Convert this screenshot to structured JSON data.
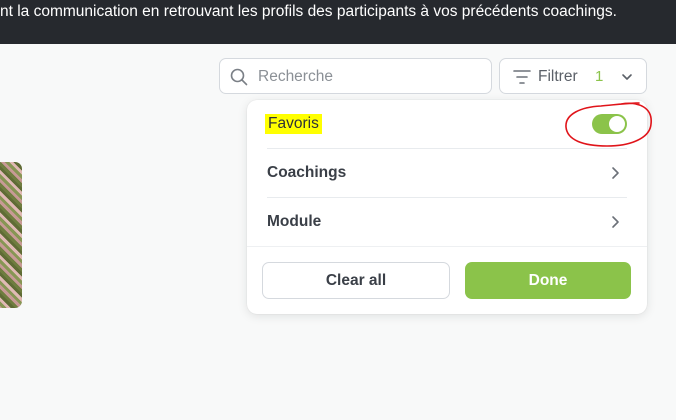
{
  "banner": {
    "text": "nt la communication en retrouvant les profils des participants à vos précédents coachings."
  },
  "search": {
    "placeholder": "Recherche",
    "icon": "search-icon"
  },
  "filter": {
    "label": "Filtrer",
    "count": "1",
    "icon": "filter-icon",
    "chevron_icon": "chevron-down-icon"
  },
  "dropdown": {
    "favorites": {
      "label": "Favoris",
      "toggle_on": true
    },
    "items": [
      {
        "label": "Coachings",
        "icon": "chevron-right-icon"
      },
      {
        "label": "Module",
        "icon": "chevron-right-icon"
      }
    ],
    "clear_label": "Clear all",
    "done_label": "Done"
  },
  "colors": {
    "accent": "#8bc34a",
    "banner_bg": "#26292e",
    "highlight": "#ffff00",
    "annotation": "#e0141a"
  }
}
